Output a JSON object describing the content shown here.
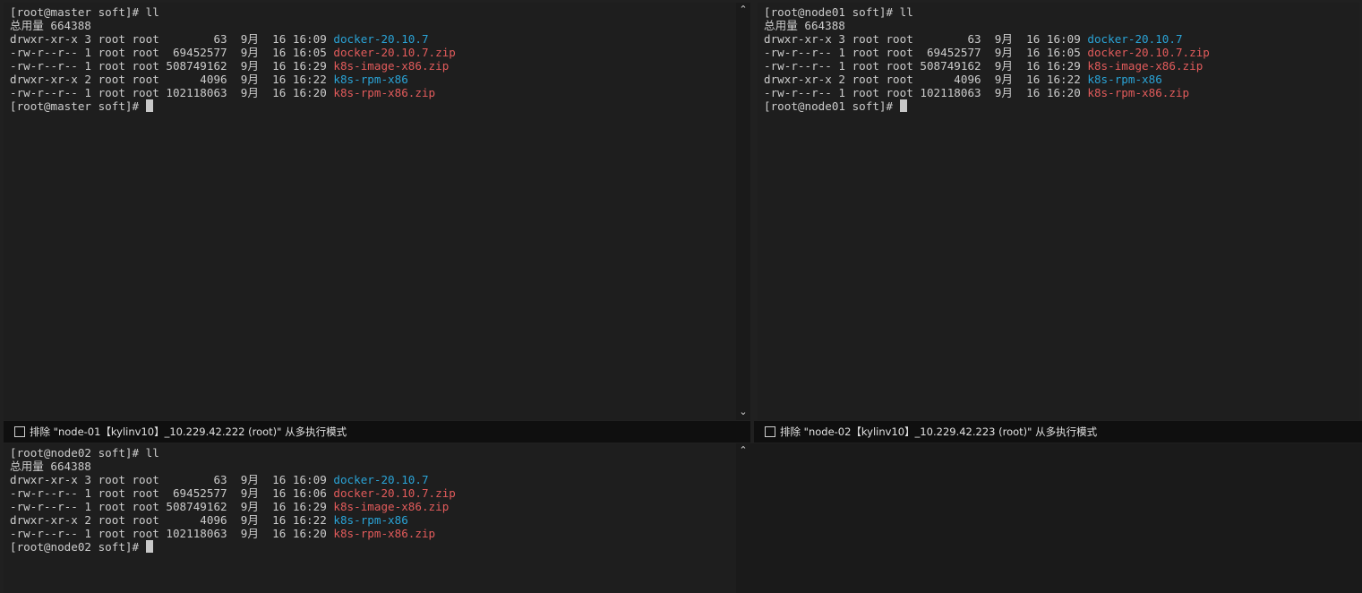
{
  "panes": {
    "master": {
      "lines": [
        "[root@master soft]# ll",
        "总用量 664388"
      ],
      "listing": [
        {
          "meta": "drwxr-xr-x 3 root root        63  9月  16 16:09 ",
          "name": "docker-20.10.7",
          "kind": "dir"
        },
        {
          "meta": "-rw-r--r-- 1 root root  69452577  9月  16 16:05 ",
          "name": "docker-20.10.7.zip",
          "kind": "zip"
        },
        {
          "meta": "-rw-r--r-- 1 root root 508749162  9月  16 16:29 ",
          "name": "k8s-image-x86.zip",
          "kind": "zip"
        },
        {
          "meta": "drwxr-xr-x 2 root root      4096  9月  16 16:22 ",
          "name": "k8s-rpm-x86",
          "kind": "dir"
        },
        {
          "meta": "-rw-r--r-- 1 root root 102118063  9月  16 16:20 ",
          "name": "k8s-rpm-x86.zip",
          "kind": "zip"
        }
      ],
      "prompt": "[root@master soft]# "
    },
    "node01": {
      "lines": [
        "[root@node01 soft]# ll",
        "总用量 664388"
      ],
      "listing": [
        {
          "meta": "drwxr-xr-x 3 root root        63  9月  16 16:09 ",
          "name": "docker-20.10.7",
          "kind": "dir"
        },
        {
          "meta": "-rw-r--r-- 1 root root  69452577  9月  16 16:05 ",
          "name": "docker-20.10.7.zip",
          "kind": "zip"
        },
        {
          "meta": "-rw-r--r-- 1 root root 508749162  9月  16 16:29 ",
          "name": "k8s-image-x86.zip",
          "kind": "zip"
        },
        {
          "meta": "drwxr-xr-x 2 root root      4096  9月  16 16:22 ",
          "name": "k8s-rpm-x86",
          "kind": "dir"
        },
        {
          "meta": "-rw-r--r-- 1 root root 102118063  9月  16 16:20 ",
          "name": "k8s-rpm-x86.zip",
          "kind": "zip"
        }
      ],
      "prompt": "[root@node01 soft]# "
    },
    "node02": {
      "lines": [
        "[root@node02 soft]# ll",
        "总用量 664388"
      ],
      "listing": [
        {
          "meta": "drwxr-xr-x 3 root root        63  9月  16 16:09 ",
          "name": "docker-20.10.7",
          "kind": "dir"
        },
        {
          "meta": "-rw-r--r-- 1 root root  69452577  9月  16 16:06 ",
          "name": "docker-20.10.7.zip",
          "kind": "zip"
        },
        {
          "meta": "-rw-r--r-- 1 root root 508749162  9月  16 16:29 ",
          "name": "k8s-image-x86.zip",
          "kind": "zip"
        },
        {
          "meta": "drwxr-xr-x 2 root root      4096  9月  16 16:22 ",
          "name": "k8s-rpm-x86",
          "kind": "dir"
        },
        {
          "meta": "-rw-r--r-- 1 root root 102118063  9月  16 16:20 ",
          "name": "k8s-rpm-x86.zip",
          "kind": "zip"
        }
      ],
      "prompt": "[root@node02 soft]# "
    }
  },
  "exclude_bars": {
    "left_label": "排除 \"node-01【kylinv10】_10.229.42.222 (root)\" 从多执行模式",
    "right_label": "排除 \"node-02【kylinv10】_10.229.42.223 (root)\" 从多执行模式",
    "left_checked": false,
    "right_checked": false
  },
  "icons": {
    "scroll_up": "chevron-up-icon",
    "scroll_down": "chevron-down-icon"
  },
  "colors": {
    "directory": "#2aa3d6",
    "archive": "#e25b5b",
    "text": "#cccccc",
    "background": "#1e1e1e"
  }
}
